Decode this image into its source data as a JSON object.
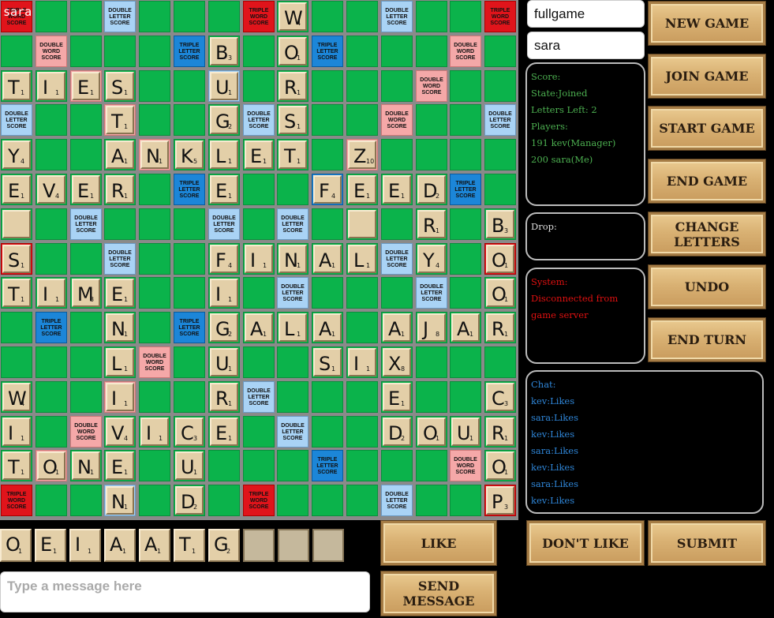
{
  "game_id": "fullgame",
  "player_name": "sara",
  "board_overlay_name": "sara",
  "board": {
    "rows": 15,
    "cols": 15,
    "premiums": {
      "TW": [
        "0,0",
        "0,7",
        "0,14",
        "7,0",
        "14,0",
        "14,7",
        "14,14",
        "7,14"
      ],
      "DW": [
        "1,1",
        "1,13",
        "2,12",
        "3,11",
        "4,10",
        "10,4",
        "11,3",
        "12,2",
        "13,13",
        "13,1",
        "1,1",
        "2,2",
        "3,3",
        "4,4"
      ],
      "TL": [
        "1,5",
        "1,9",
        "5,5",
        "5,13",
        "9,1",
        "9,5",
        "13,9",
        "5,9"
      ],
      "DL": [
        "0,3",
        "0,11",
        "3,0",
        "3,7",
        "3,14",
        "6,2",
        "6,6",
        "6,8",
        "7,3",
        "7,11",
        "8,8",
        "8,12",
        "11,7",
        "12,8",
        "14,3",
        "14,11",
        "2,6"
      ]
    },
    "premium_labels": {
      "TW": [
        "TRIPLE",
        "WORD",
        "SCORE"
      ],
      "DW": [
        "DOUBLE",
        "WORD",
        "SCORE"
      ],
      "TL": [
        "TRIPLE",
        "LETTER",
        "SCORE"
      ],
      "DL": [
        "DOUBLE",
        "LETTER",
        "SCORE"
      ]
    },
    "tiles": [
      [
        "0,8",
        "W",
        "4"
      ],
      [
        "1,6",
        "B",
        "3"
      ],
      [
        "1,8",
        "O",
        "1"
      ],
      [
        "2,0",
        "T",
        "1"
      ],
      [
        "2,1",
        "I",
        "1"
      ],
      [
        "2,2",
        "E",
        "1"
      ],
      [
        "2,3",
        "S",
        "1"
      ],
      [
        "2,6",
        "U",
        "1"
      ],
      [
        "2,8",
        "R",
        "1"
      ],
      [
        "3,3",
        "T",
        "1"
      ],
      [
        "3,6",
        "G",
        "2"
      ],
      [
        "3,8",
        "S",
        "1"
      ],
      [
        "4,0",
        "Y",
        "4"
      ],
      [
        "4,3",
        "A",
        "1"
      ],
      [
        "4,4",
        "N",
        "1"
      ],
      [
        "4,5",
        "K",
        "5"
      ],
      [
        "4,6",
        "L",
        "1"
      ],
      [
        "4,7",
        "E",
        "1"
      ],
      [
        "4,8",
        "T",
        "1"
      ],
      [
        "4,10",
        "Z",
        "10"
      ],
      [
        "5,0",
        "E",
        "1"
      ],
      [
        "5,1",
        "V",
        "4"
      ],
      [
        "5,2",
        "E",
        "1"
      ],
      [
        "5,3",
        "R",
        "1"
      ],
      [
        "5,6",
        "E",
        "1"
      ],
      [
        "5,9",
        "F",
        "4"
      ],
      [
        "5,10",
        "E",
        "1"
      ],
      [
        "5,11",
        "E",
        "1"
      ],
      [
        "5,12",
        "D",
        "2"
      ],
      [
        "6,0",
        "",
        ""
      ],
      [
        "6,10",
        "",
        ""
      ],
      [
        "6,12",
        "R",
        "1"
      ],
      [
        "6,14",
        "B",
        "3"
      ],
      [
        "7,0",
        "S",
        "1"
      ],
      [
        "7,6",
        "F",
        "4"
      ],
      [
        "7,7",
        "I",
        "1"
      ],
      [
        "7,8",
        "N",
        "1"
      ],
      [
        "7,9",
        "A",
        "1"
      ],
      [
        "7,10",
        "L",
        "1"
      ],
      [
        "7,12",
        "Y",
        "4"
      ],
      [
        "7,14",
        "O",
        "1"
      ],
      [
        "8,0",
        "T",
        "1"
      ],
      [
        "8,1",
        "I",
        "1"
      ],
      [
        "8,2",
        "M",
        "3"
      ],
      [
        "8,3",
        "E",
        "1"
      ],
      [
        "8,6",
        "I",
        "1"
      ],
      [
        "8,14",
        "O",
        "1"
      ],
      [
        "9,3",
        "N",
        "1"
      ],
      [
        "9,6",
        "G",
        "2"
      ],
      [
        "9,7",
        "A",
        "1"
      ],
      [
        "9,8",
        "L",
        "1"
      ],
      [
        "9,9",
        "A",
        "1"
      ],
      [
        "9,11",
        "A",
        "1"
      ],
      [
        "9,12",
        "J",
        "8"
      ],
      [
        "9,13",
        "A",
        "1"
      ],
      [
        "9,14",
        "R",
        "1"
      ],
      [
        "10,3",
        "L",
        "1"
      ],
      [
        "10,6",
        "U",
        "1"
      ],
      [
        "10,9",
        "S",
        "1"
      ],
      [
        "10,10",
        "I",
        "1"
      ],
      [
        "10,11",
        "X",
        "8"
      ],
      [
        "11,0",
        "W",
        "4"
      ],
      [
        "11,3",
        "I",
        "1"
      ],
      [
        "11,6",
        "R",
        "1"
      ],
      [
        "11,11",
        "E",
        "1"
      ],
      [
        "11,14",
        "C",
        "3"
      ],
      [
        "12,0",
        "I",
        "1"
      ],
      [
        "12,3",
        "V",
        "4"
      ],
      [
        "12,4",
        "I",
        "1"
      ],
      [
        "12,5",
        "C",
        "3"
      ],
      [
        "12,6",
        "E",
        "1"
      ],
      [
        "12,11",
        "D",
        "2"
      ],
      [
        "12,12",
        "O",
        "1"
      ],
      [
        "12,13",
        "U",
        "1"
      ],
      [
        "12,14",
        "R",
        "1"
      ],
      [
        "13,0",
        "T",
        "1"
      ],
      [
        "13,1",
        "O",
        "1"
      ],
      [
        "13,2",
        "N",
        "1"
      ],
      [
        "13,3",
        "E",
        "1"
      ],
      [
        "13,5",
        "U",
        "1"
      ],
      [
        "13,14",
        "O",
        "1"
      ],
      [
        "14,3",
        "N",
        "1"
      ],
      [
        "14,5",
        "D",
        "2"
      ],
      [
        "14,14",
        "P",
        "3"
      ]
    ]
  },
  "rack": [
    [
      "O",
      "1"
    ],
    [
      "E",
      "1"
    ],
    [
      "I",
      "1"
    ],
    [
      "A",
      "1"
    ],
    [
      "A",
      "1"
    ],
    [
      "T",
      "1"
    ],
    [
      "G",
      "2"
    ],
    [
      "",
      ""
    ],
    [
      "",
      ""
    ],
    [
      "",
      ""
    ]
  ],
  "status": {
    "score_label": "Score:",
    "state": "State:Joined",
    "letters_left": "Letters Left: 2",
    "players_label": "Players:",
    "players": [
      "191 kev(Manager)",
      "200 sara(Me)"
    ]
  },
  "drop_label": "Drop:",
  "system": {
    "label": "System:",
    "message": "Disconnected from game server"
  },
  "chat": {
    "label": "Chat:",
    "messages": [
      "kev:Likes",
      "sara:Likes",
      "kev:Likes",
      "sara:Likes",
      "kev:Likes",
      "sara:Likes",
      "kev:Likes"
    ]
  },
  "buttons": {
    "new_game": "New Game",
    "join_game": "Join Game",
    "start_game": "Start Game",
    "end_game": "End Game",
    "change_letters": "Change Letters",
    "undo": "Undo",
    "end_turn": "End Turn",
    "like": "Like",
    "dont_like": "Don't Like",
    "submit": "Submit",
    "send_message": "Send Message"
  },
  "message_placeholder": "Type a message here",
  "colors": {
    "board_green": "#0bb34b",
    "triple_word": "#e0141b",
    "double_word": "#f5a8a8",
    "triple_letter": "#1c86d8",
    "double_letter": "#a9d3f5",
    "tile": "#e3cfa8",
    "status_text": "#4caf50",
    "system_text": "#e01010",
    "chat_text": "#2f86d8"
  }
}
